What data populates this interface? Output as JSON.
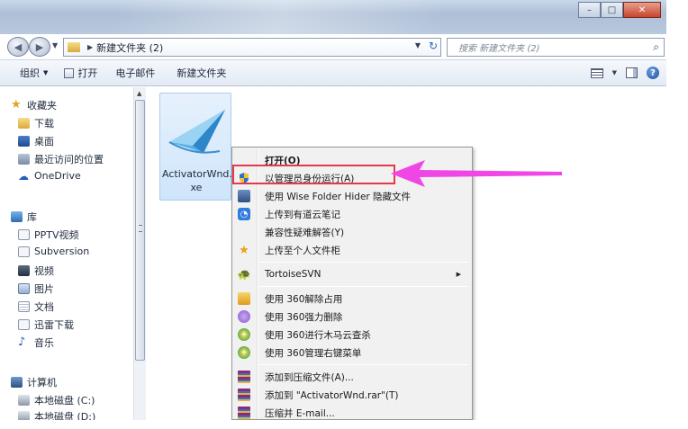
{
  "window": {
    "controls": {
      "minimize": "–",
      "maximize": "□",
      "close": "✕"
    }
  },
  "address": {
    "path": "新建文件夹 (2)",
    "search_placeholder": "搜索 新建文件夹 (2)"
  },
  "toolbar": {
    "organize": "组织",
    "open": "打开",
    "email": "电子邮件",
    "new_folder": "新建文件夹"
  },
  "nav": {
    "favorites": "收藏夹",
    "downloads": "下载",
    "desktop": "桌面",
    "recent": "最近访问的位置",
    "onedrive": "OneDrive",
    "libraries": "库",
    "pptv": "PPTV视频",
    "subversion": "Subversion",
    "videos": "视频",
    "pictures": "图片",
    "documents": "文档",
    "thunder": "迅雷下载",
    "music": "音乐",
    "computer": "计算机",
    "drive_c": "本地磁盘 (C:)",
    "drive_d": "本地磁盘 (D:)"
  },
  "file": {
    "name_line1": "ActivatorWnd.e",
    "name_line2": "xe"
  },
  "context_menu": {
    "open": "打开(O)",
    "run_as_admin": "以管理员身份运行(A)",
    "wise_hide": "使用 Wise Folder Hider 隐藏文件",
    "youdao": "上传到有道云笔记",
    "compat": "兼容性疑难解答(Y)",
    "personal_cabinet": "上传至个人文件柜",
    "tortoise": "TortoiseSVN",
    "unlock_360": "使用 360解除占用",
    "force_delete_360": "使用 360强力删除",
    "trojan_scan_360": "使用 360进行木马云查杀",
    "manage_menu_360": "使用 360管理右键菜单",
    "add_archive": "添加到压缩文件(A)...",
    "add_rar": "添加到 \"ActivatorWnd.rar\"(T)",
    "compress_email": "压缩并 E-mail..."
  },
  "colors": {
    "highlight_border": "#e23a4b",
    "arrow": "#f046e6"
  }
}
